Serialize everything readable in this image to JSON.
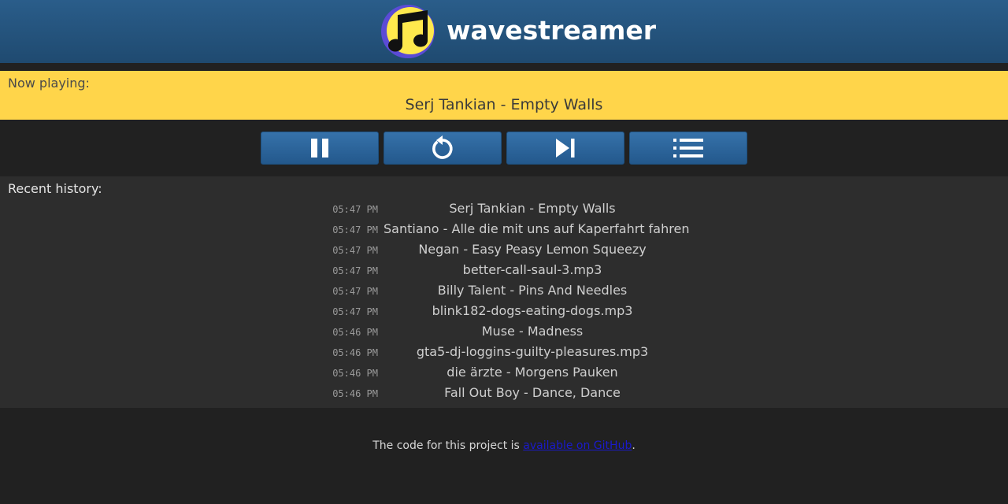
{
  "brand": {
    "name": "wavestreamer",
    "logo_icon": "music-note-icon"
  },
  "now_playing": {
    "label": "Now playing:",
    "title": "Serj Tankian - Empty Walls"
  },
  "controls": [
    {
      "name": "pause-button",
      "icon": "pause-icon"
    },
    {
      "name": "restart-button",
      "icon": "restart-icon"
    },
    {
      "name": "skip-button",
      "icon": "skip-next-icon"
    },
    {
      "name": "playlist-button",
      "icon": "list-icon"
    }
  ],
  "history": {
    "label": "Recent history:",
    "items": [
      {
        "time": "05:47 PM",
        "track": "Serj Tankian - Empty Walls"
      },
      {
        "time": "05:47 PM",
        "track": "Santiano - Alle die mit uns auf Kaperfahrt fahren"
      },
      {
        "time": "05:47 PM",
        "track": "Negan - Easy Peasy Lemon Squeezy"
      },
      {
        "time": "05:47 PM",
        "track": "better-call-saul-3.mp3"
      },
      {
        "time": "05:47 PM",
        "track": "Billy Talent - Pins And Needles"
      },
      {
        "time": "05:47 PM",
        "track": "blink182-dogs-eating-dogs.mp3"
      },
      {
        "time": "05:46 PM",
        "track": "Muse - Madness"
      },
      {
        "time": "05:46 PM",
        "track": "gta5-dj-loggins-guilty-pleasures.mp3"
      },
      {
        "time": "05:46 PM",
        "track": "die ärzte - Morgens Pauken"
      },
      {
        "time": "05:46 PM",
        "track": "Fall Out Boy - Dance, Dance"
      }
    ]
  },
  "footer": {
    "text_before": "The code for this project is ",
    "link_text": "available on GitHub",
    "text_after": "."
  },
  "colors": {
    "header": "#2a5d8a",
    "now_playing_bg": "#ffd54a",
    "button": "#2f6699",
    "page_bg": "#212121",
    "history_bg": "#2d2d2d"
  }
}
